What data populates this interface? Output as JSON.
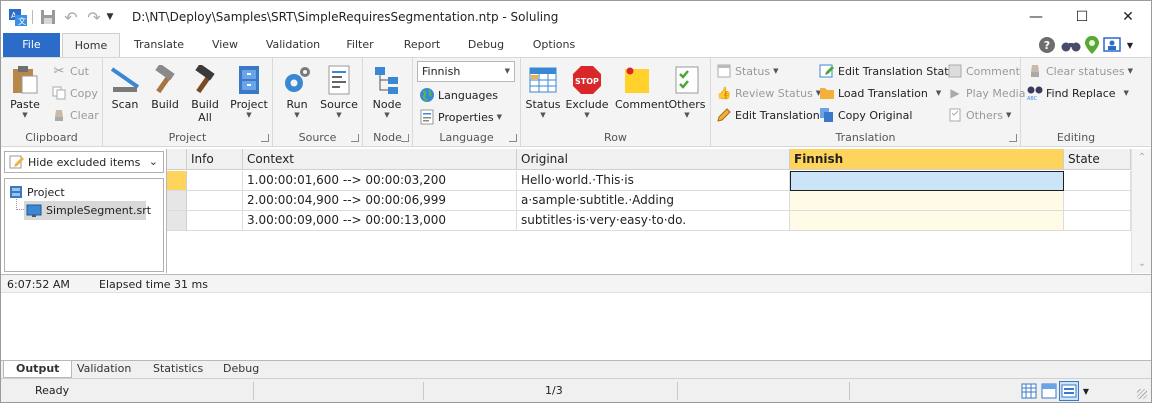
{
  "window": {
    "title": "D:\\NT\\Deploy\\Samples\\SRT\\SimpleRequiresSegmentation.ntp  -  Soluling",
    "minimize": "—",
    "maximize": "☐",
    "close": "✕"
  },
  "tabs": [
    "File",
    "Home",
    "Translate",
    "View",
    "Validation",
    "Filter",
    "Report",
    "Debug",
    "Options"
  ],
  "ribbon": {
    "clipboard": {
      "label": "Clipboard",
      "paste": "Paste",
      "cut": "Cut",
      "copy": "Copy",
      "clear": "Clear"
    },
    "project": {
      "label": "Project",
      "scan": "Scan",
      "build": "Build",
      "build_all_1": "Build",
      "build_all_2": "All",
      "project": "Project"
    },
    "source": {
      "label": "Source",
      "run": "Run",
      "source": "Source"
    },
    "node": {
      "label": "Node",
      "node": "Node"
    },
    "language": {
      "label": "Language",
      "selected": "Finnish",
      "languages": "Languages",
      "properties": "Properties"
    },
    "row": {
      "label": "Row",
      "status": "Status",
      "exclude": "Exclude",
      "comment": "Comment",
      "others": "Others"
    },
    "translation": {
      "label": "Translation",
      "status": "Status",
      "review_status": "Review Status",
      "edit_translation": "Edit Translation",
      "edit_translation_state": "Edit Translation State",
      "load_translation": "Load Translation",
      "copy_original": "Copy Original",
      "comment": "Comment",
      "play_media": "Play Media",
      "others": "Others"
    },
    "editing": {
      "label": "Editing",
      "clear_statuses": "Clear statuses",
      "find_replace": "Find  Replace"
    }
  },
  "left_pane": {
    "filter": "Hide excluded items",
    "tree": {
      "root": "Project",
      "child": "SimpleSegment.srt"
    }
  },
  "grid": {
    "columns": [
      "Info",
      "Context",
      "Original",
      "Finnish",
      "State"
    ],
    "rows": [
      {
        "context": "1.00:00:01,600 --> 00:00:03,200",
        "original": "Hello·world.·This·is",
        "finnish": "",
        "state": ""
      },
      {
        "context": "2.00:00:04,900 --> 00:00:06,999",
        "original": "a·sample·subtitle.·Adding",
        "finnish": "",
        "state": ""
      },
      {
        "context": "3.00:00:09,000 --> 00:00:13,000",
        "original": "subtitles·is·very·easy·to·do.",
        "finnish": "",
        "state": ""
      }
    ]
  },
  "output": {
    "time": "6:07:52 AM",
    "message": "Elapsed time 31 ms"
  },
  "output_tabs": [
    "Output",
    "Validation",
    "Statistics",
    "Debug"
  ],
  "status": {
    "ready": "Ready",
    "position": "1/3"
  },
  "colors": {
    "accent": "#2a6cc8",
    "highlight_header": "#ffd45c",
    "selected_cell": "#cce4f7",
    "target_bg": "#fffbe6"
  }
}
